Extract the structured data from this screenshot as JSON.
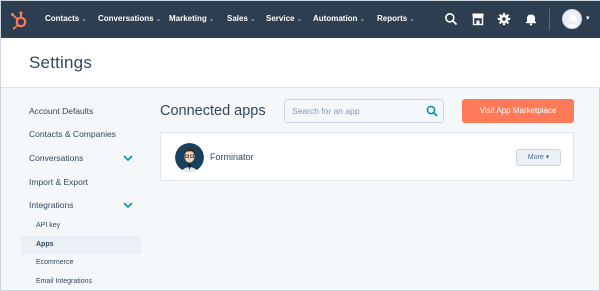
{
  "topnav": {
    "items": [
      {
        "label": "Contacts"
      },
      {
        "label": "Conversations"
      },
      {
        "label": "Marketing"
      },
      {
        "label": "Sales"
      },
      {
        "label": "Service"
      },
      {
        "label": "Automation"
      },
      {
        "label": "Reports"
      }
    ],
    "icons": [
      "search-icon",
      "marketplace-icon",
      "gear-icon",
      "bell-icon"
    ],
    "brand_color": "#ff7a59",
    "bar_color": "#2d3e50"
  },
  "header": {
    "title": "Settings"
  },
  "sidebar": {
    "items": [
      {
        "label": "Account Defaults"
      },
      {
        "label": "Contacts & Companies"
      },
      {
        "label": "Conversations"
      },
      {
        "label": "Import & Export"
      },
      {
        "label": "Integrations"
      }
    ],
    "subitems": [
      {
        "label": "API key"
      },
      {
        "label": "Apps"
      },
      {
        "label": "Ecommerce"
      },
      {
        "label": "Email Integrations"
      }
    ]
  },
  "main": {
    "title": "Connected apps",
    "search_placeholder": "Search for an app",
    "marketplace_button": "Visit App Marketplace",
    "apps": [
      {
        "name": "Forminator",
        "more_label": "More"
      }
    ]
  }
}
